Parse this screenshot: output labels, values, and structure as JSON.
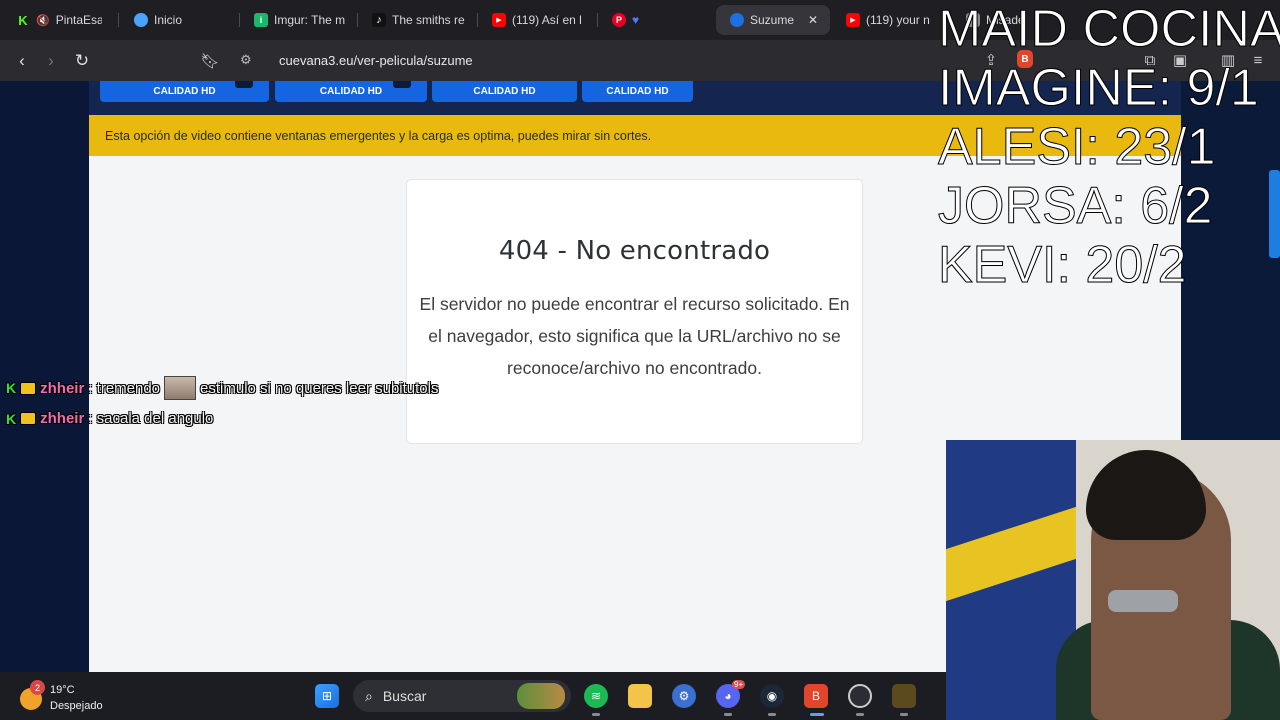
{
  "tabs": [
    {
      "title": "PintaEsa",
      "icon": "kick-icon",
      "color": "#53fc18"
    },
    {
      "title": "Inicio",
      "icon": "eye-icon",
      "color": "#4aa3ff"
    },
    {
      "title": "Imgur: The m",
      "icon": "imgur-icon",
      "color": "#1bb76e"
    },
    {
      "title": "The smiths re",
      "icon": "tiktok-icon",
      "color": "#111111"
    },
    {
      "title": "(119) Así en l",
      "icon": "youtube-icon",
      "color": "#ff0000"
    },
    {
      "title": "",
      "icon": "pinterest-icon",
      "color": "#e60023"
    },
    {
      "title": "Suzume",
      "icon": "cuevana-icon",
      "color": "#1e6fe0",
      "active": true
    },
    {
      "title": "(119) your n",
      "icon": "youtube-icon",
      "color": "#ff0000"
    },
    {
      "title": "Misade",
      "icon": "generic-icon",
      "color": "#888888"
    }
  ],
  "address": {
    "url": "cuevana3.eu/ver-pelicula/suzume"
  },
  "server_buttons": [
    "CALIDAD HD",
    "CALIDAD HD",
    "CALIDAD HD",
    "CALIDAD HD"
  ],
  "notice": "Esta opción de video contiene ventanas emergentes y la carga es optima, puedes mirar sin cortes.",
  "error": {
    "title": "404 - No encontrado",
    "message": "El servidor no puede encontrar el recurso solicitado. En el navegador, esto significa que la URL/archivo no se reconoce/archivo no encontrado."
  },
  "scoreboard": [
    "MAID COCINA",
    "IMAGINE: 9/1",
    "ALESI: 23/1",
    "JORSA: 6/2",
    "KEVI: 20/2"
  ],
  "chat": [
    {
      "user": "zhheir",
      "message": ": tremendo",
      "after_emote": "estimulo si no queres leer subitutols"
    },
    {
      "user": "zhheir",
      "message": ": sacala del angulo",
      "after_emote": ""
    }
  ],
  "taskbar": {
    "weather_temp": "19°C",
    "weather_desc": "Despejado",
    "weather_badge": "2",
    "search_placeholder": "Buscar",
    "discord_badge": "9+"
  }
}
